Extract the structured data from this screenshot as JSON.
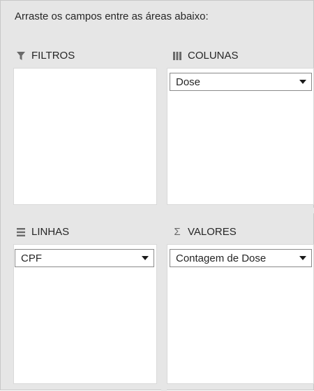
{
  "instruction": "Arraste os campos entre as áreas abaixo:",
  "areas": {
    "filters": {
      "label": "FILTROS",
      "icon": "filter-icon"
    },
    "columns": {
      "label": "COLUNAS",
      "icon": "columns-icon",
      "fields": [
        "Dose"
      ]
    },
    "rows": {
      "label": "LINHAS",
      "icon": "rows-icon",
      "fields": [
        "CPF"
      ]
    },
    "values": {
      "label": "VALORES",
      "icon": "sigma-icon",
      "icon_glyph": "Σ",
      "fields": [
        "Contagem de Dose"
      ]
    }
  },
  "colors": {
    "panel_bg": "#e6e6e6",
    "box_bg": "#ffffff",
    "pill_border": "#8a8a8a"
  }
}
